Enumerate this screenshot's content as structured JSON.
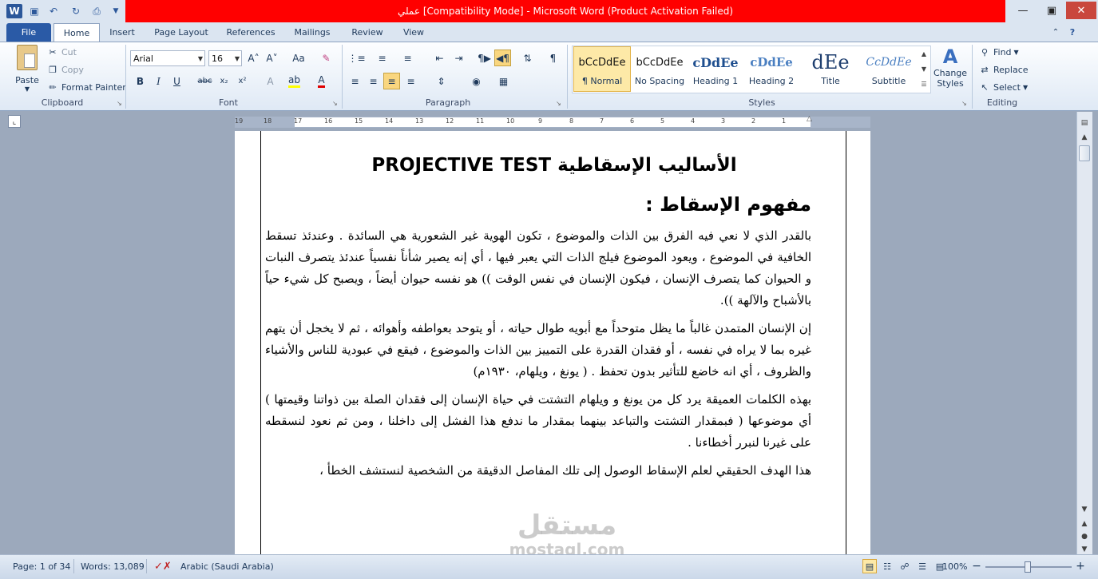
{
  "window": {
    "title": "عملي [Compatibility Mode]  -  Microsoft Word (Product Activation Failed)",
    "title_band_color": "#ff0000"
  },
  "qat": {
    "icons": [
      "word-icon",
      "save-icon",
      "undo-icon",
      "redo-icon",
      "print-preview-icon",
      "customize-qat-icon"
    ]
  },
  "tabs": [
    {
      "label": "File"
    },
    {
      "label": "Home"
    },
    {
      "label": "Insert"
    },
    {
      "label": "Page Layout"
    },
    {
      "label": "References"
    },
    {
      "label": "Mailings"
    },
    {
      "label": "Review"
    },
    {
      "label": "View"
    }
  ],
  "ribbon": {
    "clipboard": {
      "label": "Clipboard",
      "paste": "Paste",
      "cut": "Cut",
      "copy": "Copy",
      "format_painter": "Format Painter"
    },
    "font": {
      "label": "Font",
      "font_name": "Arial",
      "font_size": "16"
    },
    "paragraph": {
      "label": "Paragraph"
    },
    "styles": {
      "label": "Styles",
      "items": [
        {
          "preview": "bCcDdEe",
          "name": "¶ Normal"
        },
        {
          "preview": "bCcDdEe",
          "name": "No Spacing"
        },
        {
          "preview": "cDdEe",
          "name": "Heading 1"
        },
        {
          "preview": "cDdEe",
          "name": "Heading 2"
        },
        {
          "preview": "dEe",
          "name": "Title"
        },
        {
          "preview": "CcDdEe",
          "name": "Subtitle"
        }
      ],
      "change_styles": "Change Styles"
    },
    "editing": {
      "label": "Editing",
      "find": "Find",
      "replace": "Replace",
      "select": "Select"
    }
  },
  "ruler": {
    "ticks": [
      "19",
      "18",
      "17",
      "16",
      "15",
      "14",
      "13",
      "12",
      "11",
      "10",
      "9",
      "8",
      "7",
      "6",
      "5",
      "4",
      "3",
      "2",
      "1"
    ]
  },
  "document": {
    "title": "الأساليب الإسقاطية PROJECTIVE TEST",
    "heading": "مفهوم الإسقاط :",
    "paragraphs": [
      "بالقدر الذي لا نعي فيه الفرق بين الذات والموضوع ، تكون الهوية غير الشعورية هي السائدة . وعندئذ تسقط الخافية في الموضوع ، ويعود الموضوع فيلج الذات التي يعبر فيها ، أي إنه يصير شأناً نفسياً عندئذ يتصرف النبات و الحيوان كما يتصرف الإنسان ، فيكون الإنسان في نفس الوقت )) هو نفسه حيوان أيضاً ، ويصبح كل شيء حياً بالأشباح والآلهة )).",
      "إن الإنسان المتمدن غالباً ما يظل متوحداً مع أبويه طوال حياته ، أو يتوحد بعواطفه وأهوائه ، ثم لا يخجل أن يتهم غيره بما لا يراه في نفسه ، أو فقدان القدرة على التمييز بين الذات والموضوع ، فيقع في عبودية للناس والأشياء والظروف ، أي انه خاضع للتأثير بدون تحفظ . ( يونغ ، ويلهام، ١٩٣٠م)",
      "بهذه الكلمات العميقة يرد كل من يونغ و ويلهام التشتت في حياة الإنسان إلى فقدان الصلة بين ذواتنا وقيمتها ) أي موضوعها ( فبمقدار التشتت والتباعد بينهما بمقدار ما ندفع هذا الفشل إلى داخلنا ، ومن ثم نعود لنسقطه على غيرنا لنبرر أخطاءنا .",
      "هذا الهدف الحقيقي لعلم الإسقاط الوصول إلى تلك المفاصل الدقيقة من الشخصية لنستشف الخطأ ،"
    ]
  },
  "status": {
    "page": "Page: 1 of 34",
    "words": "Words: 13,089",
    "language": "Arabic (Saudi Arabia)",
    "zoom": "100%"
  },
  "watermark": {
    "line1": "مستقل",
    "line2": "mostaql.com"
  }
}
